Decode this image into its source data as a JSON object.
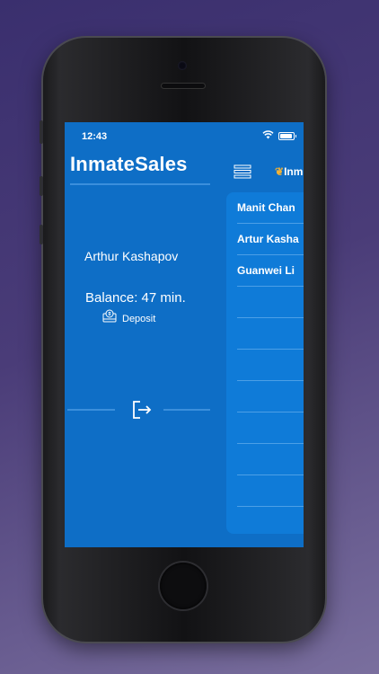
{
  "status_bar": {
    "time": "12:43"
  },
  "brand": {
    "name": "InmateSales",
    "mini_logo_text": "Inm"
  },
  "sidebar": {
    "user_name": "Arthur Kashapov",
    "balance": "Balance: 47 min.",
    "deposit_label": "Deposit"
  },
  "contacts": [
    {
      "name": "Manit Chan"
    },
    {
      "name": "Artur Kasha"
    },
    {
      "name": "Guanwei Li"
    },
    {
      "name": ""
    },
    {
      "name": ""
    },
    {
      "name": ""
    },
    {
      "name": ""
    },
    {
      "name": ""
    },
    {
      "name": ""
    },
    {
      "name": ""
    }
  ],
  "colors": {
    "screen_bg": "#0e6ec6",
    "panel_bg": "#0f7bd8",
    "accent_line": "#3b8fdc",
    "logo_flame": "#f2b134",
    "backdrop": "#3a2f6e"
  },
  "icons": [
    "wifi-icon",
    "battery-icon",
    "deposit-icon",
    "logout-icon",
    "menu-icon",
    "flame-icon"
  ]
}
